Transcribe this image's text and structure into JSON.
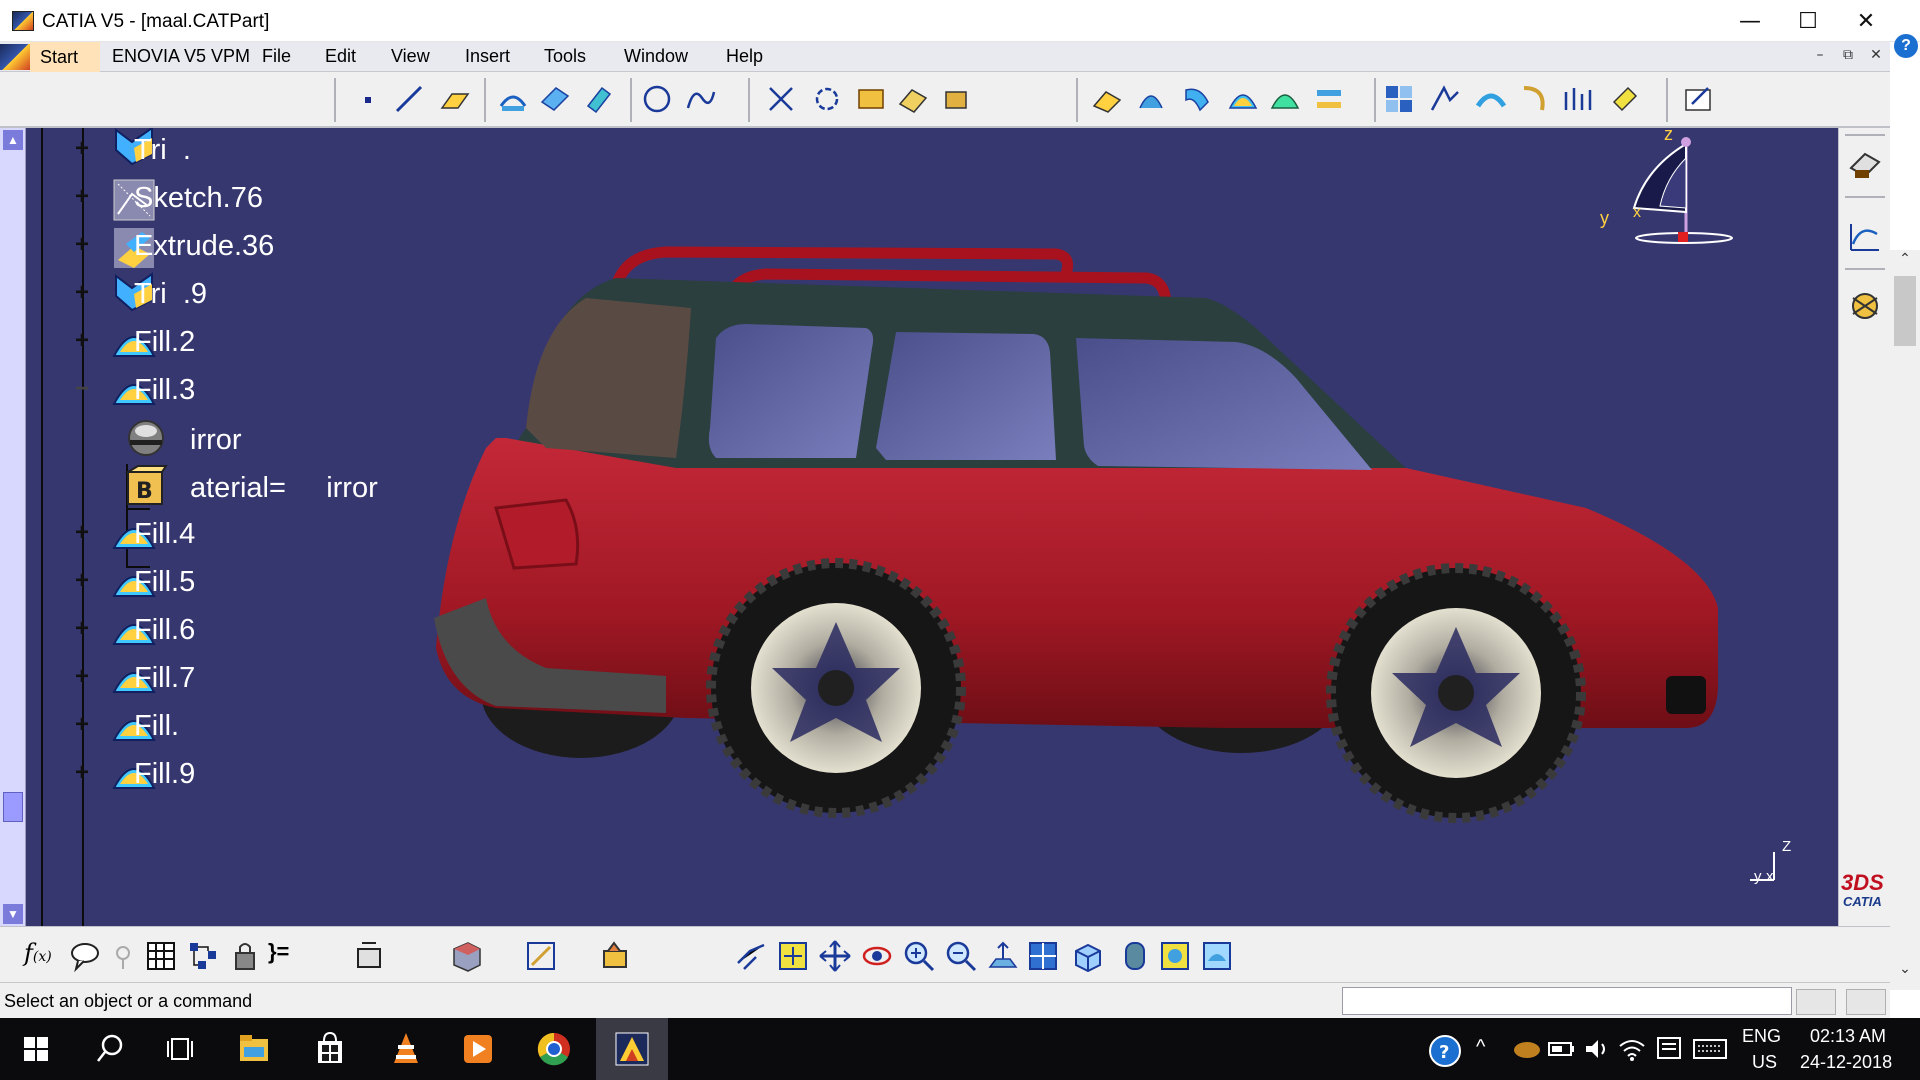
{
  "window": {
    "title": "CATIA V5 - [maal.CATPart]",
    "controls": [
      "—",
      "☐",
      "✕"
    ]
  },
  "menu": {
    "start": "Start",
    "items": [
      "ENOVIA V5 VPM",
      "File",
      "Edit",
      "View",
      "Insert",
      "Tools",
      "Window",
      "Help"
    ],
    "mdi_controls": [
      "–",
      "⧉",
      "✕"
    ],
    "help_bubble": "?"
  },
  "tree": {
    "nodes": [
      {
        "label": "Tri  .",
        "icon": "surface-icon",
        "expander": "+"
      },
      {
        "label": "Sketch.76",
        "icon": "sketch-icon",
        "expander": "+"
      },
      {
        "label": "Extrude.36",
        "icon": "extrude-icon",
        "expander": "+"
      },
      {
        "label": "Tri  .9",
        "icon": "surface-icon",
        "expander": "+"
      },
      {
        "label": "Fill.2",
        "icon": "fill-icon",
        "expander": "+"
      },
      {
        "label": "Fill.3",
        "icon": "fill-icon",
        "expander": "−"
      },
      {
        "label": "irror",
        "icon": "material-sphere-icon",
        "expander": ""
      },
      {
        "label": "aterial=     irror",
        "icon": "material-box-icon",
        "expander": ""
      },
      {
        "label": "Fill.4",
        "icon": "fill-icon",
        "expander": "+"
      },
      {
        "label": "Fill.5",
        "icon": "fill-icon",
        "expander": "+"
      },
      {
        "label": "Fill.6",
        "icon": "fill-icon",
        "expander": "+"
      },
      {
        "label": "Fill.7",
        "icon": "fill-icon",
        "expander": "+"
      },
      {
        "label": "Fill.",
        "icon": "fill-icon",
        "expander": "+"
      },
      {
        "label": "Fill.9",
        "icon": "fill-icon",
        "expander": "+"
      }
    ]
  },
  "compass": {
    "z": "z",
    "y": "y",
    "x": "x"
  },
  "axis_triad": {
    "z": "Z",
    "y": "y",
    "x": "x"
  },
  "brand": {
    "ds": "3DS",
    "catia": "CATIA"
  },
  "status": {
    "message": "Select an object or a command",
    "command_value": ""
  },
  "taskbar": {
    "apps": [
      "windows-start-icon",
      "search-icon",
      "task-view-icon",
      "file-explorer-icon",
      "store-icon",
      "vlc-icon",
      "media-player-icon",
      "chrome-icon",
      "catia-task-icon"
    ],
    "lang_top": "ENG",
    "lang_bottom": "US",
    "time": "02:13 AM",
    "date": "24-12-2018"
  },
  "colors": {
    "viewport_bg": "#373770",
    "car_body": "#a01824",
    "car_roof": "#2a3f3e",
    "glass": "#5a5e9a",
    "start_highlight": "#ffe2b8",
    "scrollbar": "#d8d8ff"
  }
}
